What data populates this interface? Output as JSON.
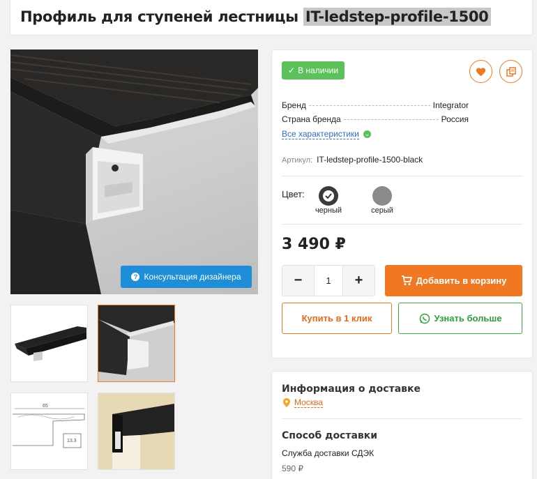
{
  "product": {
    "title_main": "Профиль для ступеней лестницы",
    "title_model": "IT-ledstep-profile-1500"
  },
  "gallery": {
    "consult_label": "Консультация дизайнера",
    "thumbnails": [
      "thumb-1",
      "thumb-2",
      "thumb-3",
      "thumb-4"
    ],
    "diagram_dims": [
      "65",
      "13.3"
    ]
  },
  "info": {
    "availability": "В наличии",
    "specs": [
      {
        "label": "Бренд",
        "value": "Integrator"
      },
      {
        "label": "Страна бренда",
        "value": "Россия"
      }
    ],
    "all_specs_link": "Все характеристики",
    "sku_label": "Артикул:",
    "sku_value": "IT-ledstep-profile-1500-black",
    "color_label": "Цвет:",
    "colors": [
      {
        "name": "черный",
        "hex": "#3a3a3a"
      },
      {
        "name": "серый",
        "hex": "#8a8a8a"
      }
    ],
    "price": "3 490 ₽",
    "quantity": "1",
    "qty_minus": "−",
    "qty_plus": "+",
    "add_to_cart": "Добавить в корзину",
    "buy_one_click": "Купить в 1 клик",
    "learn_more": "Узнать больше"
  },
  "delivery": {
    "title": "Информация о доставке",
    "city": "Москва",
    "method_title": "Способ доставки",
    "service": "Служба доставки СДЭК",
    "service_price": "590 ₽"
  },
  "colors": {
    "accent": "#f07822",
    "success": "#5cc15b",
    "link": "#2f6ec8",
    "consult": "#1d8ed7"
  }
}
